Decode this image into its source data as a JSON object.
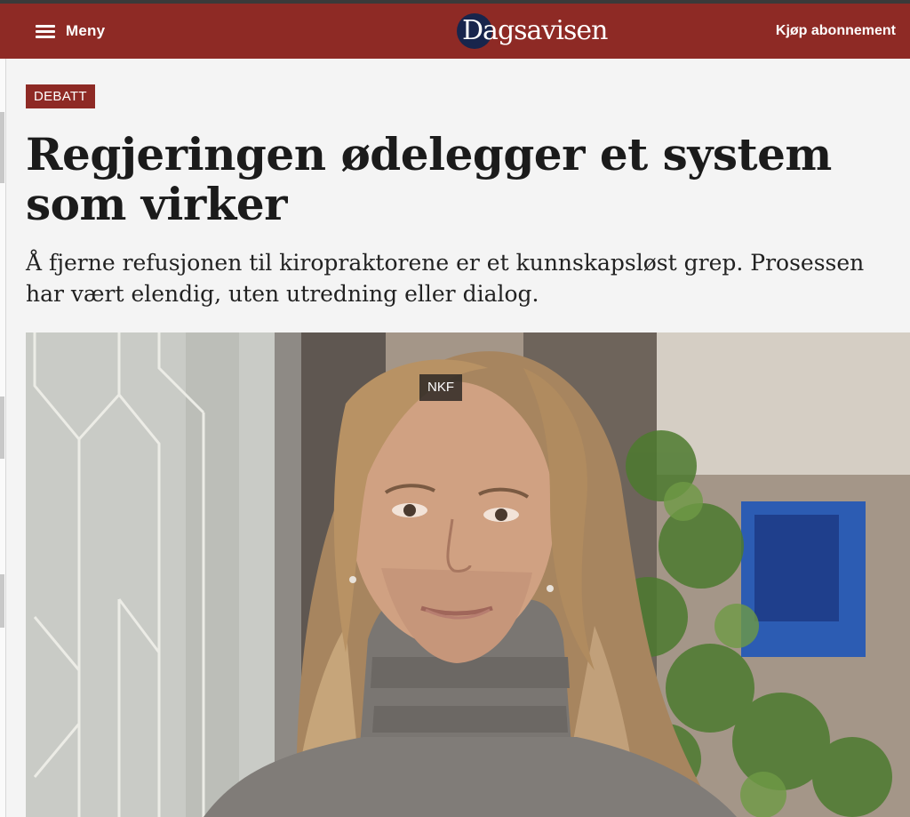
{
  "header": {
    "menu_label": "Meny",
    "logo_text": "Dagsavisen",
    "subscribe_label": "Kjøp abonnement",
    "background": "#8e2a25"
  },
  "article": {
    "category": "DEBATT",
    "headline": "Regjeringen ødelegger et system som virker",
    "lead": "Å fjerne refusjonen til kiropraktorene er et kunnskapsløst grep. Prosessen har vært elendig, uten utredning eller dialog.",
    "image": {
      "credit": "NKF"
    }
  },
  "icons": {
    "menu": "hamburger-icon"
  }
}
